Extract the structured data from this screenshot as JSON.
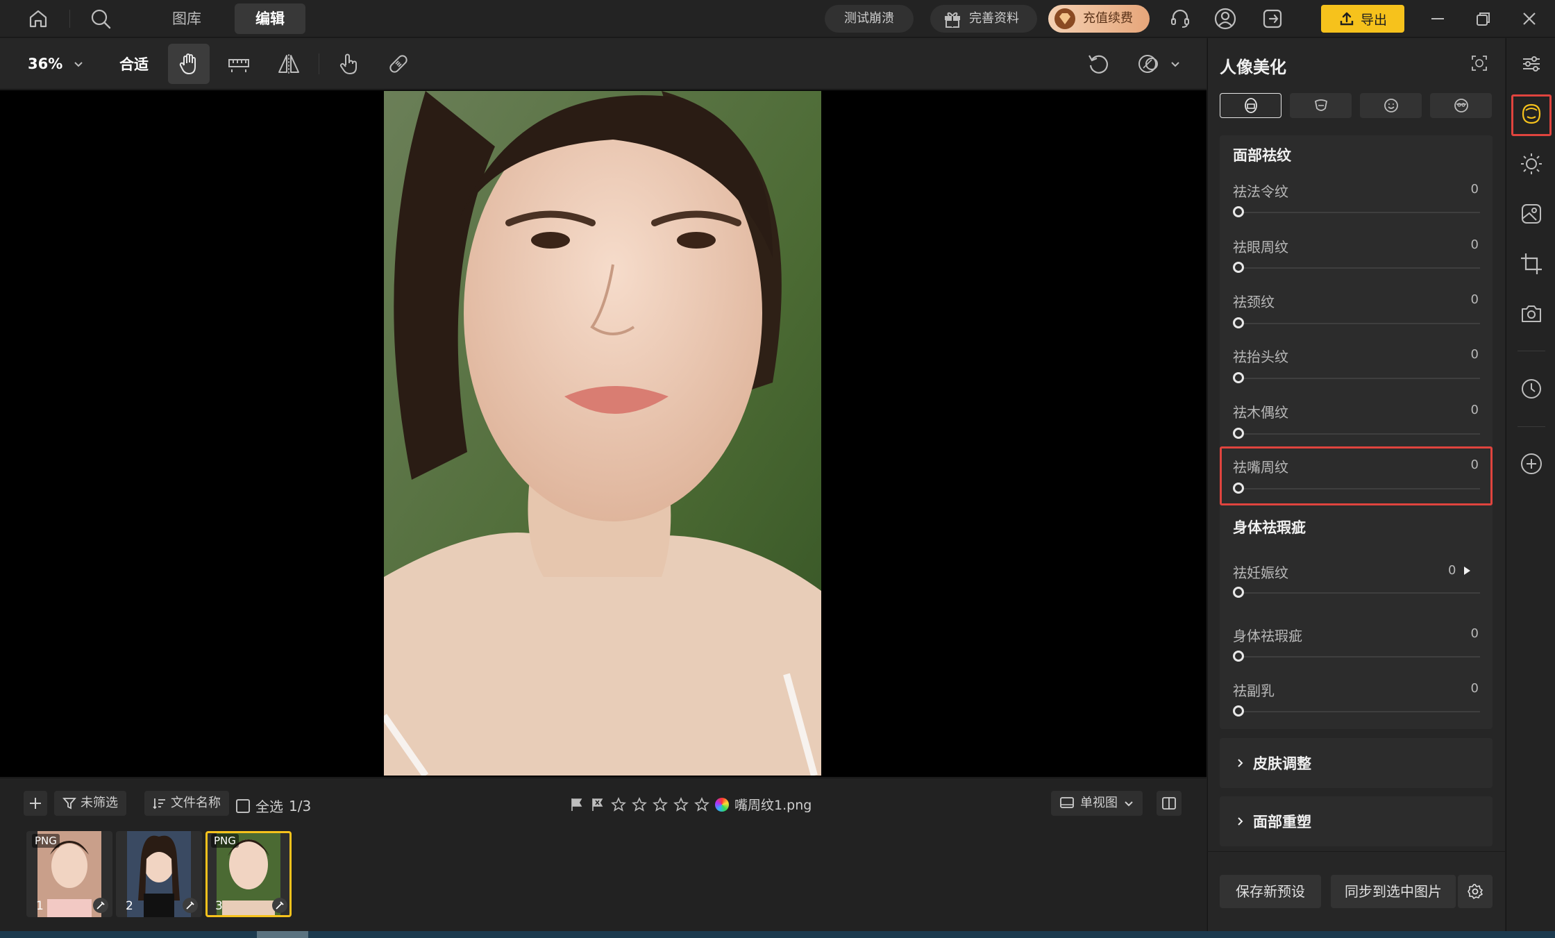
{
  "topbar": {
    "tabs": [
      {
        "label": "图库",
        "active": false
      },
      {
        "label": "编辑",
        "active": true
      }
    ],
    "crash_test_label": "测试崩溃",
    "complete_profile_label": "完善资料",
    "recharge_label": "充值续费",
    "export_label": "导出"
  },
  "toolbar": {
    "zoom": "36%",
    "fit_label": "合适"
  },
  "filmstrip": {
    "filter_label": "未筛选",
    "sort_label": "文件名称",
    "select_all_label": "全选",
    "count": "1/3",
    "filename": "嘴周纹1.png",
    "view_mode_label": "单视图",
    "thumbnails": [
      {
        "number": "1",
        "tag": "PNG",
        "selected": false
      },
      {
        "number": "2",
        "tag": "",
        "selected": false
      },
      {
        "number": "3",
        "tag": "PNG",
        "selected": true
      }
    ]
  },
  "panel": {
    "title": "人像美化",
    "section_face": {
      "title": "面部祛纹",
      "sliders": [
        {
          "label": "祛法令纹",
          "value": "0"
        },
        {
          "label": "祛眼周纹",
          "value": "0"
        },
        {
          "label": "祛颈纹",
          "value": "0"
        },
        {
          "label": "祛抬头纹",
          "value": "0"
        },
        {
          "label": "祛木偶纹",
          "value": "0"
        },
        {
          "label": "祛嘴周纹",
          "value": "0"
        }
      ]
    },
    "section_body": {
      "title": "身体祛瑕疵",
      "sliders": [
        {
          "label": "祛妊娠纹",
          "value": "0"
        },
        {
          "label": "身体祛瑕疵",
          "value": "0"
        },
        {
          "label": "祛副乳",
          "value": "0"
        }
      ]
    },
    "skin_adjust_label": "皮肤调整",
    "face_reshape_label": "面部重塑",
    "save_preset_label": "保存新预设",
    "sync_label": "同步到选中图片"
  },
  "colors": {
    "accent": "#f6c21c",
    "highlight": "#e0443e"
  }
}
